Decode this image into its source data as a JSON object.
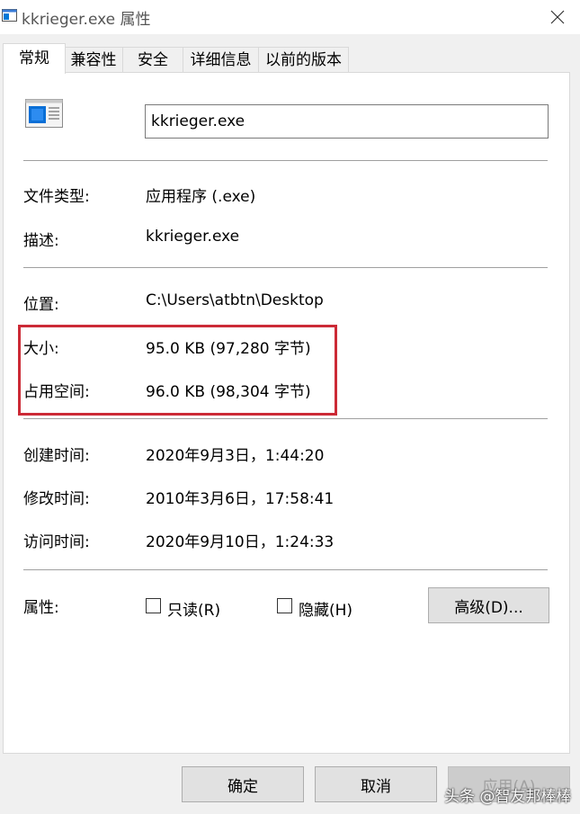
{
  "window": {
    "title": "kkrieger.exe 属性"
  },
  "tabs": [
    {
      "label": "常规"
    },
    {
      "label": "兼容性"
    },
    {
      "label": "安全"
    },
    {
      "label": "详细信息"
    },
    {
      "label": "以前的版本"
    }
  ],
  "file_name": "kkrieger.exe",
  "details": {
    "type_label": "文件类型:",
    "type_value": "应用程序 (.exe)",
    "desc_label": "描述:",
    "desc_value": "kkrieger.exe",
    "location_label": "位置:",
    "location_value": "C:\\Users\\atbtn\\Desktop",
    "size_label": "大小:",
    "size_value": "95.0 KB (97,280 字节)",
    "disk_label": "占用空间:",
    "disk_value": "96.0 KB (98,304 字节)",
    "created_label": "创建时间:",
    "created_value": "2020年9月3日，1:44:20",
    "modified_label": "修改时间:",
    "modified_value": "2010年3月6日，17:58:41",
    "accessed_label": "访问时间:",
    "accessed_value": "2020年9月10日，1:24:33"
  },
  "attributes": {
    "label": "属性:",
    "readonly_label": "只读(R)",
    "readonly_checked": false,
    "hidden_label": "隐藏(H)",
    "hidden_checked": false,
    "advanced_label": "高级(D)..."
  },
  "buttons": {
    "ok": "确定",
    "cancel": "取消",
    "apply": "应用(A)"
  },
  "watermark": "头条 @智友邦棒棒",
  "colors": {
    "highlight_border": "#cc2a36",
    "accent": "#0078d7"
  }
}
